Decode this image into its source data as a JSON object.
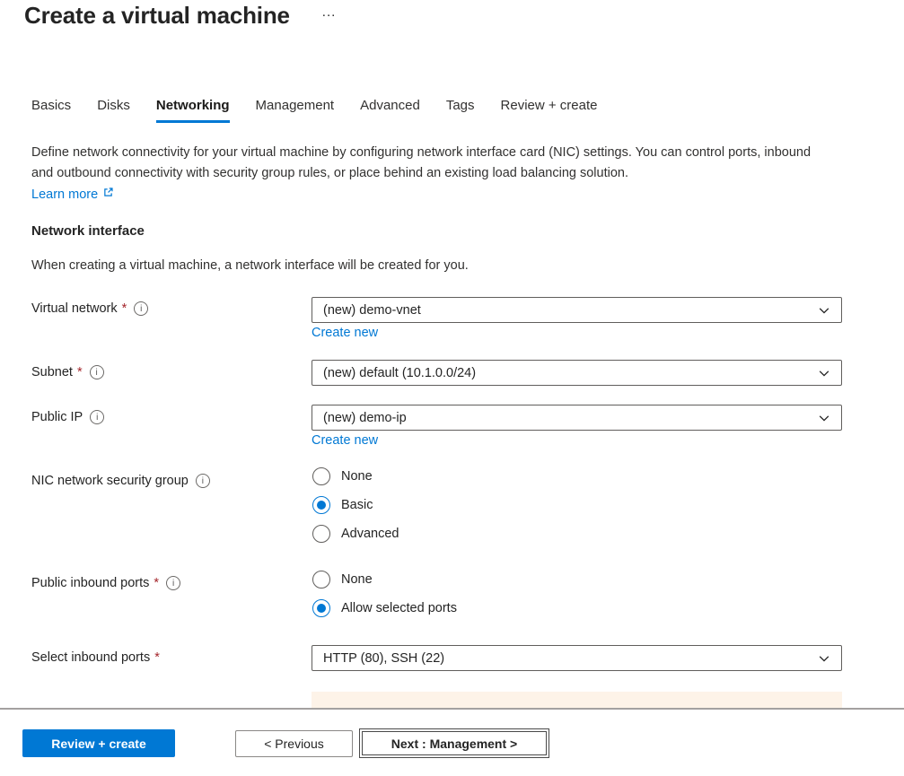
{
  "ui": {
    "required_mark": "*",
    "info_glyph": "i"
  },
  "header": {
    "title": "Create a virtual machine",
    "more_button": "..."
  },
  "tabs": [
    {
      "label": "Basics",
      "active": false
    },
    {
      "label": "Disks",
      "active": false
    },
    {
      "label": "Networking",
      "active": true
    },
    {
      "label": "Management",
      "active": false
    },
    {
      "label": "Advanced",
      "active": false
    },
    {
      "label": "Tags",
      "active": false
    },
    {
      "label": "Review + create",
      "active": false
    }
  ],
  "intro": {
    "description": "Define network connectivity for your virtual machine by configuring network interface card (NIC) settings. You can control ports, inbound and outbound connectivity with security group rules, or place behind an existing load balancing solution.",
    "learn_more_label": "Learn more"
  },
  "section": {
    "heading": "Network interface",
    "subheading": "When creating a virtual machine, a network interface will be created for you."
  },
  "fields": {
    "virtual_network": {
      "label": "Virtual network",
      "required": true,
      "value": "(new) demo-vnet",
      "create_new_label": "Create new"
    },
    "subnet": {
      "label": "Subnet",
      "required": true,
      "value": "(new) default (10.1.0.0/24)"
    },
    "public_ip": {
      "label": "Public IP",
      "required": false,
      "value": "(new) demo-ip",
      "create_new_label": "Create new"
    },
    "nic_nsg": {
      "label": "NIC network security group",
      "required": false,
      "options": [
        "None",
        "Basic",
        "Advanced"
      ],
      "selected": "Basic"
    },
    "public_inbound_ports": {
      "label": "Public inbound ports",
      "required": true,
      "options": [
        "None",
        "Allow selected ports"
      ],
      "selected": "Allow selected ports"
    },
    "select_inbound_ports": {
      "label": "Select inbound ports",
      "required": true,
      "value": "HTTP (80), SSH (22)"
    }
  },
  "footer": {
    "review_create_label": "Review + create",
    "previous_label": "< Previous",
    "next_label": "Next : Management >"
  },
  "colors": {
    "accent": "#0078d4",
    "link": "#0078d4",
    "required": "#a4262c",
    "warning_bg": "#fdf3e8"
  }
}
